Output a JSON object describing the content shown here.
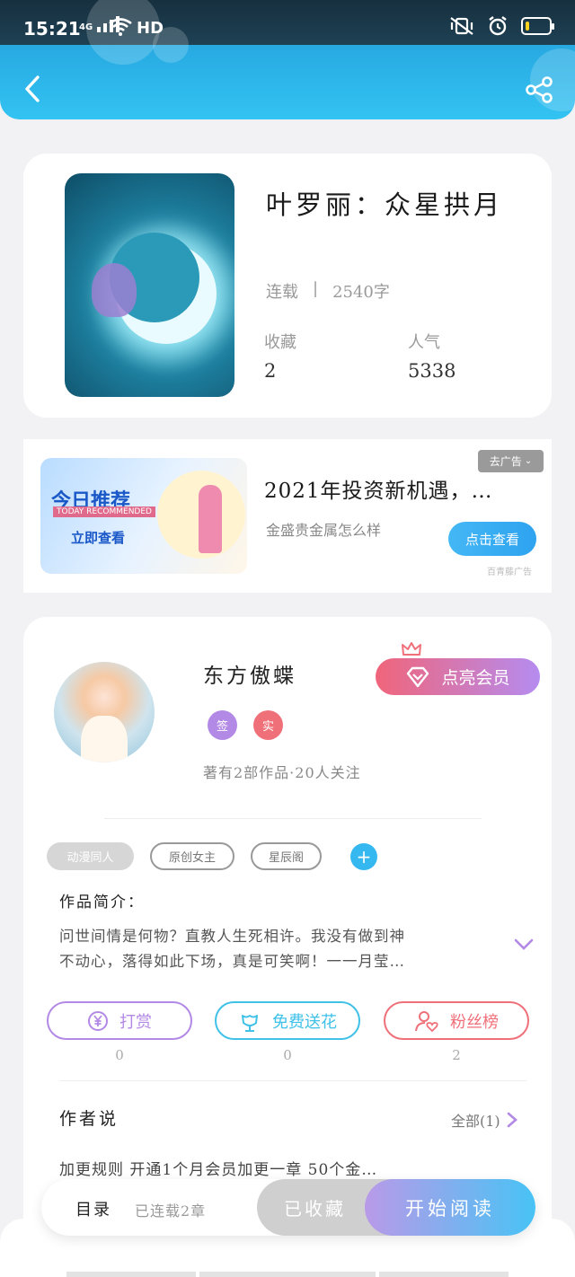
{
  "status_bar": {
    "time": "15:21",
    "network": "4G",
    "hd": "HD",
    "battery_level": 0.15
  },
  "header": {
    "back_icon": "chevron-left-icon",
    "share_icon": "share-icon"
  },
  "book": {
    "title": "叶罗丽：众星拱月",
    "status": "连载",
    "separator": "|",
    "word_count": "2540字",
    "collect_label": "收藏",
    "collect_value": "2",
    "popularity_label": "人气",
    "popularity_value": "5338"
  },
  "ad": {
    "close_label": "去广告",
    "banner_title": "今日推荐",
    "banner_subtitle": "TODAY RECOMMENDED",
    "banner_cta": "立即查看",
    "title": "2021年投资新机遇，…",
    "subtitle": "金盛贵金属怎么样",
    "button": "点击查看",
    "source": "百青藤广告"
  },
  "author": {
    "name": "东方傲蝶",
    "badge_sign": "签",
    "badge_real": "实",
    "stats": "著有2部作品·20人关注",
    "vip_button": "点亮会员",
    "colors": {
      "badge_sign": "#b389e6",
      "badge_real": "#f0707a"
    }
  },
  "tags": [
    "动漫同人",
    "原创女主",
    "星辰阁"
  ],
  "intro": {
    "label": "作品简介：",
    "text_line1": "问世间情是何物？直教人生死相许。我没有做到神",
    "text_line2": "不动心，落得如此下场，真是可笑啊！一一月莹…"
  },
  "actions": [
    {
      "label": "打赏",
      "icon": "yen-coin-icon",
      "count": "0",
      "color": "#b389e6"
    },
    {
      "label": "免费送花",
      "icon": "flower-icon",
      "count": "0",
      "color": "#3fc1e8"
    },
    {
      "label": "粉丝榜",
      "icon": "user-heart-icon",
      "count": "2",
      "color": "#f0707a"
    }
  ],
  "author_say": {
    "label": "作者说",
    "all_link": "全部(1)",
    "text": "加更规则 开通1个月会员加更一章 50个金…"
  },
  "bottom_bar": {
    "toc": "目录",
    "chapters": "已连载2章",
    "collected": "已收藏",
    "read": "开始阅读"
  }
}
